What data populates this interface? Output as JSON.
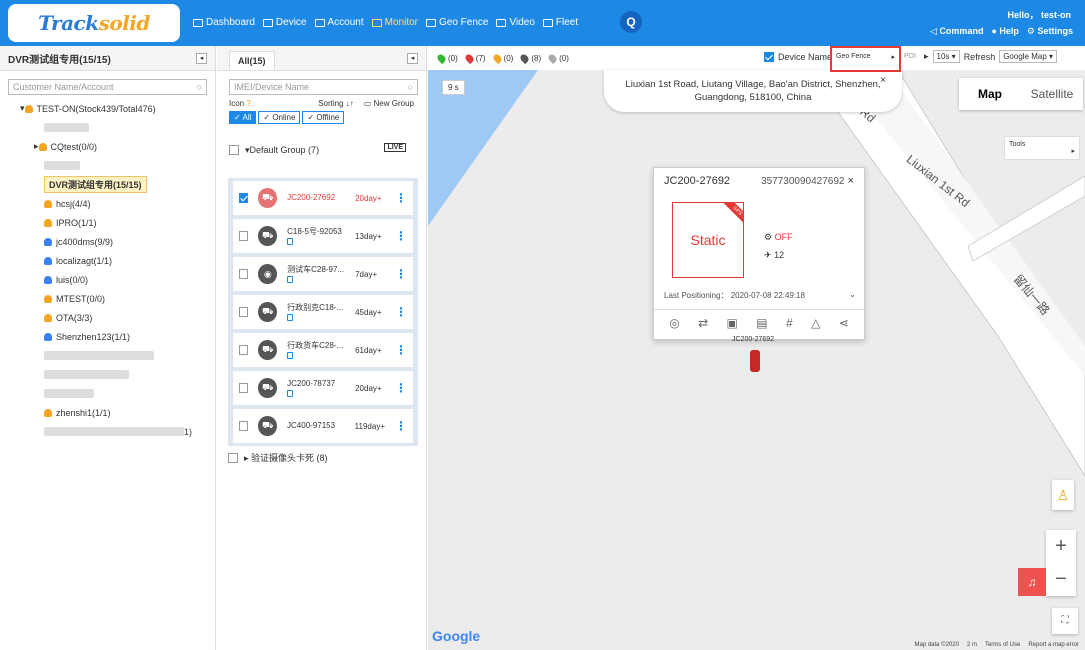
{
  "header": {
    "logo_text_main": "Track",
    "logo_text_sub": "solid",
    "nav": [
      {
        "label": "Dashboard",
        "icon": "dashboard-icon"
      },
      {
        "label": "Device",
        "icon": "device-icon"
      },
      {
        "label": "Account",
        "icon": "account-icon"
      },
      {
        "label": "Monitor",
        "icon": "monitor-icon",
        "active": true
      },
      {
        "label": "Geo Fence",
        "icon": "geofence-icon"
      },
      {
        "label": "Video",
        "icon": "video-icon"
      },
      {
        "label": "Fleet",
        "icon": "fleet-icon"
      }
    ],
    "hello": "Hello，  test-on",
    "command": "Command",
    "help": "Help",
    "settings": "Settings",
    "search_glyph": "Q"
  },
  "left_panel": {
    "title": "DVR测试组专用(15/15)",
    "search_placeholder": "Customer Name/Account",
    "tree": [
      {
        "label": "TEST-ON(Stock439/Total476)",
        "level": 0
      },
      {
        "label": "",
        "level": 1,
        "blur": 45
      },
      {
        "label": "CQtest(0/0)",
        "level": 1
      },
      {
        "label": "",
        "level": 1,
        "blur": 36
      },
      {
        "label": "DVR测试组专用(15/15)",
        "level": 1,
        "selected": true
      },
      {
        "label": "hcsj(4/4)",
        "level": 1
      },
      {
        "label": "IPRO(1/1)",
        "level": 1
      },
      {
        "label": "jc400dms(9/9)",
        "level": 1,
        "blue": true
      },
      {
        "label": "localizagt(1/1)",
        "level": 1,
        "blue": true
      },
      {
        "label": "luis(0/0)",
        "level": 1,
        "blue": true
      },
      {
        "label": "MTEST(0/0)",
        "level": 1
      },
      {
        "label": "OTA(3/3)",
        "level": 1
      },
      {
        "label": "Shenzhen123(1/1)",
        "level": 1,
        "blue": true
      },
      {
        "label": "",
        "level": 1,
        "blur": 110
      },
      {
        "label": "",
        "level": 1,
        "blur": 85
      },
      {
        "label": "",
        "level": 1,
        "blur": 50
      },
      {
        "label": "zhenshi1(1/1)",
        "level": 1
      },
      {
        "label": "1)",
        "level": 1,
        "blur": 140
      }
    ]
  },
  "mid_panel": {
    "tab": "All(15)",
    "search_placeholder": "IMEI/Device Name",
    "icon_label": "Icon",
    "sorting_label": "Sorting",
    "new_group": "New Group",
    "filters": [
      "All",
      "Online",
      "Offline"
    ],
    "live_badge": "LIVE",
    "group_name": "Default Group (7)",
    "devices": [
      {
        "name": "JC200-27692",
        "days": "20day+",
        "checked": true,
        "red": true
      },
      {
        "name": "C18-5号-92053",
        "days": "13day+"
      },
      {
        "name": "测试车C28-97...",
        "days": "7day+",
        "round": true
      },
      {
        "name": "行政别克C18-...",
        "days": "45day+"
      },
      {
        "name": "行政货车C28-...",
        "days": "61day+"
      },
      {
        "name": "JC200-78737",
        "days": "20day+"
      },
      {
        "name": "JC400-97153",
        "days": "119day+",
        "nophone": true
      }
    ],
    "subgroup": "验证摄像头卡死 (8)"
  },
  "map": {
    "legend": [
      {
        "count": "(0)",
        "color": "#2eb82e"
      },
      {
        "count": "(7)",
        "color": "#e53935"
      },
      {
        "count": "(0)",
        "color": "#f5a623"
      },
      {
        "count": "(8)",
        "color": "#555555"
      },
      {
        "count": "(0)",
        "color": "#aaaaaa"
      }
    ],
    "device_name_label": "Device Name",
    "geo_fence_label": "Geo Fence",
    "poi_label": "POI",
    "interval": "10s",
    "refresh": "Refresh",
    "map_type": "Google Map",
    "address_line1": "Liuxian 1st Road, Liutang Village, Bao'an District, Shenzhen,",
    "address_line2": "Guangdong, 518100, China",
    "timer": "9 s",
    "map_btn": "Map",
    "satellite_btn": "Satellite",
    "tools": "Tools",
    "road1": "Liuxian 1st Rd",
    "road2": "留仙一路",
    "road3": "Rd",
    "popup": {
      "name": "JC200-27692",
      "imei": "357730090427692",
      "status": "Static",
      "gps": "GPS",
      "acc": "OFF",
      "satellites": "12",
      "last_positioning": "Last Positioning： 2020-07-08 22:49:18"
    },
    "car_label": "JC200-27692",
    "google": "Google",
    "attribution": [
      "Map data ©2020",
      "2 m",
      "Terms of Use",
      "Report a map error"
    ]
  }
}
